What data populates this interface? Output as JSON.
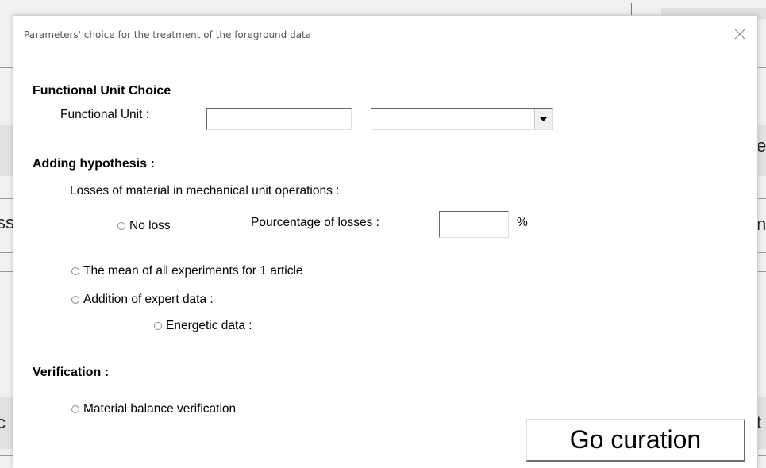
{
  "background": {
    "fragment_right_1": "e",
    "fragment_left_2": "ss",
    "fragment_right_2": "n",
    "fragment_left_3": "c",
    "fragment_right_3": "t"
  },
  "dialog": {
    "title": "Parameters' choice for the treatment of the foreground data",
    "close_icon": "close-icon",
    "functional_unit_section": {
      "heading": "Functional Unit Choice",
      "label": "Functional Unit :",
      "text_value": "",
      "combo_value": ""
    },
    "hypothesis_section": {
      "heading": "Adding hypothesis :",
      "losses_label": "Losses of material in mechanical unit operations :",
      "no_loss_label": "No loss",
      "percentage_label": "Pourcentage of losses :",
      "percentage_value": "",
      "percent_sign": "%",
      "mean_label": "The mean of all experiments for 1 article",
      "expert_label": "Addition of expert data :",
      "energetic_label": "Energetic data :"
    },
    "verification_section": {
      "heading": "Verification :",
      "material_balance_label": "Material balance verification"
    },
    "go_button_label": "Go curation"
  }
}
